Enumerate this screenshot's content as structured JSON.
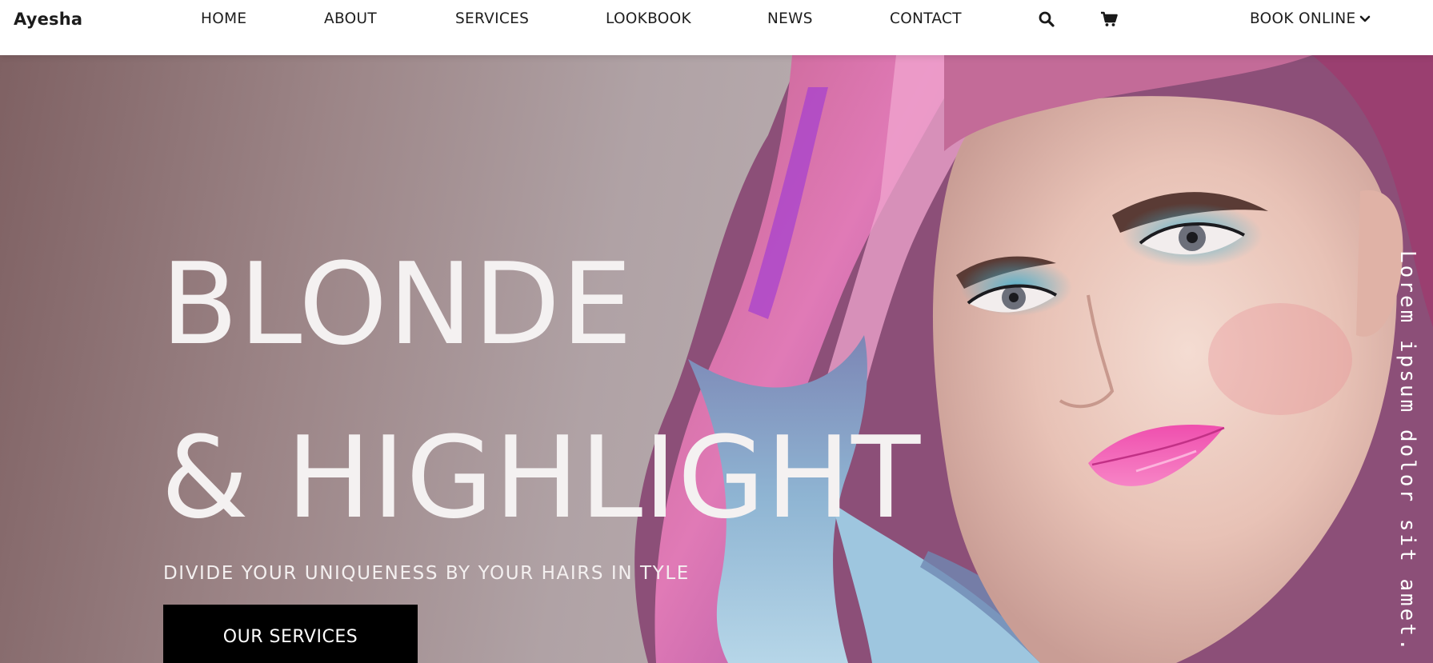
{
  "header": {
    "brand": "Ayesha",
    "nav": [
      {
        "label": "HOME"
      },
      {
        "label": "ABOUT"
      },
      {
        "label": "SERVICES"
      },
      {
        "label": "LOOKBOOK"
      },
      {
        "label": "NEWS"
      },
      {
        "label": "CONTACT"
      }
    ],
    "icons": {
      "search": "search-icon",
      "cart": "cart-icon"
    },
    "book_online": "BOOK ONLINE"
  },
  "hero": {
    "headline_line1": "BLONDE",
    "headline_line2": "& HIGHLIGHT",
    "tagline": "DIVIDE YOUR UNIQUENESS BY YOUR HAIRS IN TYLE",
    "cta_label": "OUR SERVICES",
    "side_text": "Lorem ipsum dolor sit amet."
  },
  "colors": {
    "header_bg": "#ffffff",
    "hero_bg": "#a89598",
    "headline": "#f4f1f1",
    "cta_bg": "#000000",
    "cta_text": "#ffffff"
  }
}
